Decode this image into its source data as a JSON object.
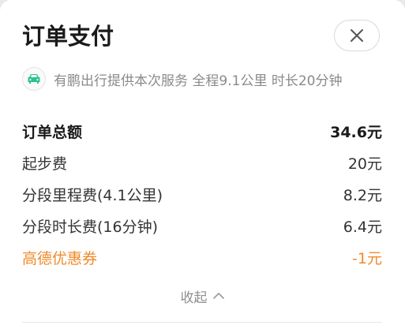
{
  "header": {
    "title": "订单支付",
    "close_icon": "close-icon"
  },
  "provider": {
    "icon": "car-icon",
    "text": "有鹏出行提供本次服务 全程9.1公里 时长20分钟"
  },
  "fees": [
    {
      "label": "订单总额",
      "value": "34.6元"
    },
    {
      "label": "起步费",
      "value": "20元"
    },
    {
      "label": "分段里程费(4.1公里)",
      "value": "8.2元"
    },
    {
      "label": "分段时长费(16分钟)",
      "value": "6.4元"
    },
    {
      "label": "高德优惠券",
      "value": "-1元"
    }
  ],
  "collapse": {
    "label": "收起",
    "icon": "chevron-up-icon"
  },
  "colors": {
    "discount": "#f08a2a",
    "car_icon": "#2cc38b"
  }
}
